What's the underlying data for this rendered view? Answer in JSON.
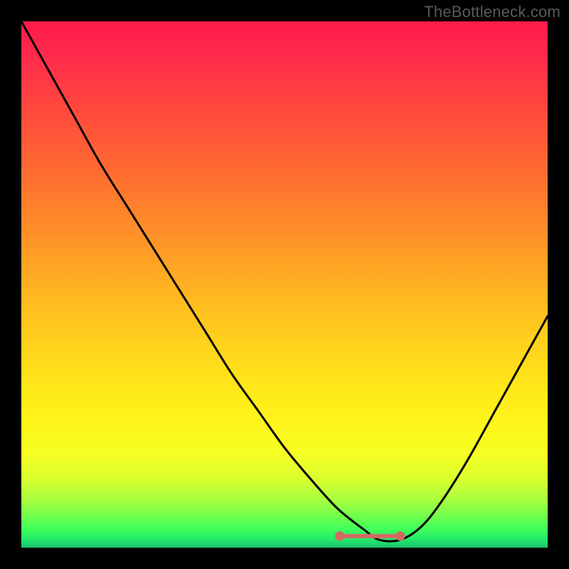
{
  "attribution": "TheBottleneck.com",
  "colors": {
    "curve_stroke": "#000000",
    "indicator_stroke": "#d46a63",
    "indicator_fill": "#d46a63"
  },
  "chart_data": {
    "type": "line",
    "title": "",
    "xlabel": "",
    "ylabel": "",
    "xlim": [
      0,
      100
    ],
    "ylim": [
      0,
      100
    ],
    "grid": false,
    "legend": false,
    "series": [
      {
        "name": "bottleneck-curve",
        "x": [
          0,
          5,
          10,
          15,
          20,
          25,
          30,
          35,
          40,
          45,
          50,
          55,
          60,
          65,
          68,
          72,
          76,
          80,
          85,
          90,
          95,
          100
        ],
        "values": [
          100,
          91,
          82,
          73,
          65,
          57,
          49,
          41,
          33,
          26,
          19,
          13,
          7.5,
          3.5,
          1.5,
          1.5,
          4,
          9,
          17,
          26,
          35,
          44
        ]
      }
    ],
    "indicator": {
      "x_start": 60.5,
      "x_end": 72.0,
      "y": 2.2,
      "end_dot_radius": 0.9
    }
  }
}
